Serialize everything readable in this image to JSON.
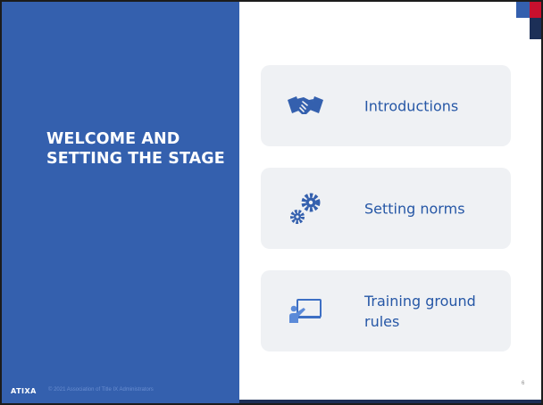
{
  "slide": {
    "title": "WELCOME AND SETTING THE STAGE",
    "footer": {
      "logo_text": "ATIXA",
      "copyright": "© 2021 Association of Title IX Administrators"
    },
    "page_number": "6",
    "colors": {
      "panel": "#3460ae",
      "card_background": "#eff1f4",
      "card_text": "#2657a6",
      "accent_red": "#c8102e",
      "accent_navy": "#1c2f57"
    }
  },
  "agenda": [
    {
      "label": "Introductions",
      "icon": "handshake-icon"
    },
    {
      "label": "Setting norms",
      "icon": "gears-icon"
    },
    {
      "label": "Training ground rules",
      "icon": "presentation-icon"
    }
  ]
}
